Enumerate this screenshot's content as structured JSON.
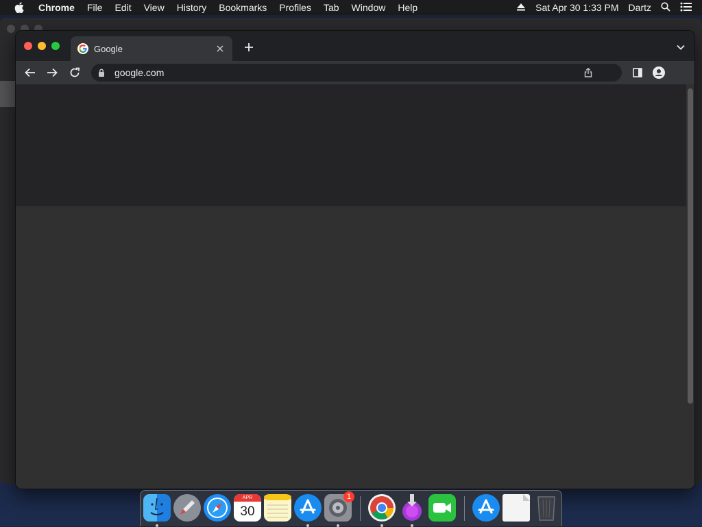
{
  "menubar": {
    "app_name": "Chrome",
    "items": [
      "File",
      "Edit",
      "View",
      "History",
      "Bookmarks",
      "Profiles",
      "Tab",
      "Window",
      "Help"
    ],
    "datetime": "Sat Apr 30  1:33 PM",
    "user": "Dartz"
  },
  "browser": {
    "tab_title": "Google",
    "url": "google.com"
  },
  "dock": {
    "calendar_day": "30",
    "calendar_month": "APR",
    "settings_badge": "1"
  },
  "colors": {
    "close_light": "#ff5f57",
    "minimize_light": "#febc2e",
    "zoom_light": "#28c840",
    "tab_bg": "#35363a",
    "content_bg": "#303031"
  }
}
